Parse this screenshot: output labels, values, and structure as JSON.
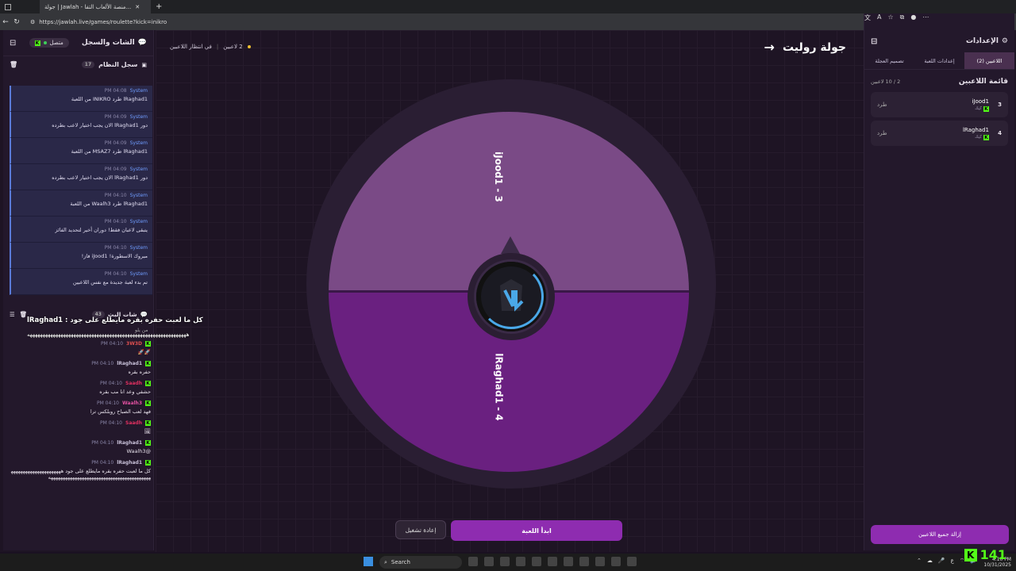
{
  "browser": {
    "tab_title": "جولة | Jawlah - منصة الألعاب التفا...",
    "url": "https://jawlah.live/games/roulette?kick=inikro"
  },
  "left_panel": {
    "title": "الشات والسجل",
    "connection_status": "متصل",
    "system_log_title": "سجل النظام",
    "system_log_count": "17",
    "system_messages": [
      {
        "sender": "System",
        "time": "PM 04:08",
        "text": "lRaghad1 طرد INIKRO من اللعبة"
      },
      {
        "sender": "System",
        "time": "PM 04:09",
        "text": "دور lRaghad1 الان يجب اختيار لاعب بطرده"
      },
      {
        "sender": "System",
        "time": "PM 04:09",
        "text": "lRaghad1 طرد MSAZ7 من اللعبة"
      },
      {
        "sender": "System",
        "time": "PM 04:09",
        "text": "دور lRaghad1 الان يجب اختيار لاعب بطرده"
      },
      {
        "sender": "System",
        "time": "PM 04:10",
        "text": "lRaghad1 طرد Waalh3 من اللعبة"
      },
      {
        "sender": "System",
        "time": "PM 04:10",
        "text": "يتبقى لاعبان فقط! دوران أخير لتحديد الفائز"
      },
      {
        "sender": "System",
        "time": "PM 04:10",
        "text": "مبروك الاسطورة! iJood1 فاز!"
      },
      {
        "sender": "System",
        "time": "PM 04:10",
        "text": "تم بدء لعبة جديدة مع نفس اللاعبين"
      }
    ],
    "chat_title": "شات البث",
    "chat_count": "43",
    "chat_messages": [
      {
        "name": "3W3D",
        "time": "PM 04:10",
        "text": "🚀🚀"
      },
      {
        "name": "lRaghad1",
        "time": "PM 04:10",
        "text": "حفره بقره"
      },
      {
        "name": "Saadh",
        "time": "PM 04:10",
        "text": "حشفي وعد انا مب بقره"
      },
      {
        "name": "Waalh3",
        "time": "PM 04:10",
        "text": "فهد لعب الصباح روبلكس ترا"
      },
      {
        "name": "Saadh",
        "time": "PM 04:10",
        "text": "🖼"
      },
      {
        "name": "lRaghad1",
        "time": "PM 04:10",
        "text": "@Waalh3"
      },
      {
        "name": "lRaghad1",
        "time": "PM 04:10",
        "text": "كل ما لعبت حفره بقره مايطلع على جود ههههههههههههههههههههههههههههههههههههههههههههههههههههههههههههههههه"
      }
    ],
    "ticker_line1": "كل ما لعبت حفره بقره مايطلع على جود : lRaghad1",
    "ticker_line2": "ههههههههههههههههههههههههههههههههههههههههههههههههههههههههههههههه",
    "ticker_sub": "من يلو"
  },
  "center": {
    "waiting_count": "2 لاعبين",
    "waiting_label": "في انتظار اللاعبين",
    "title": "جولة روليت",
    "segments": [
      {
        "label": "iJood1 - 3",
        "color": "#7a4a86"
      },
      {
        "label": "lRaghad1 - 4",
        "color": "#6a2080"
      }
    ],
    "start_button": "ابدأ اللعبة",
    "reset_button": "إعادة تشغيل"
  },
  "right_panel": {
    "title": "الإعدادات",
    "tabs": [
      "اللاعبين (2)",
      "إعدادات اللعبة",
      "تصميم العجلة"
    ],
    "players_title": "قائمة اللاعبين",
    "players_count": "2 / 10 لاعبين",
    "players": [
      {
        "num": "3",
        "name": "iJood1",
        "platform": "كيك",
        "kick": "طرد"
      },
      {
        "num": "4",
        "name": "lRaghad1",
        "platform": "كيك",
        "kick": "طرد"
      }
    ],
    "remove_all": "إزالة جميع اللاعبين"
  },
  "overlay": {
    "kick_count": "141"
  },
  "taskbar": {
    "search": "Search",
    "time": "4:10 PM",
    "date": "10/31/2025",
    "lang": "ع"
  }
}
